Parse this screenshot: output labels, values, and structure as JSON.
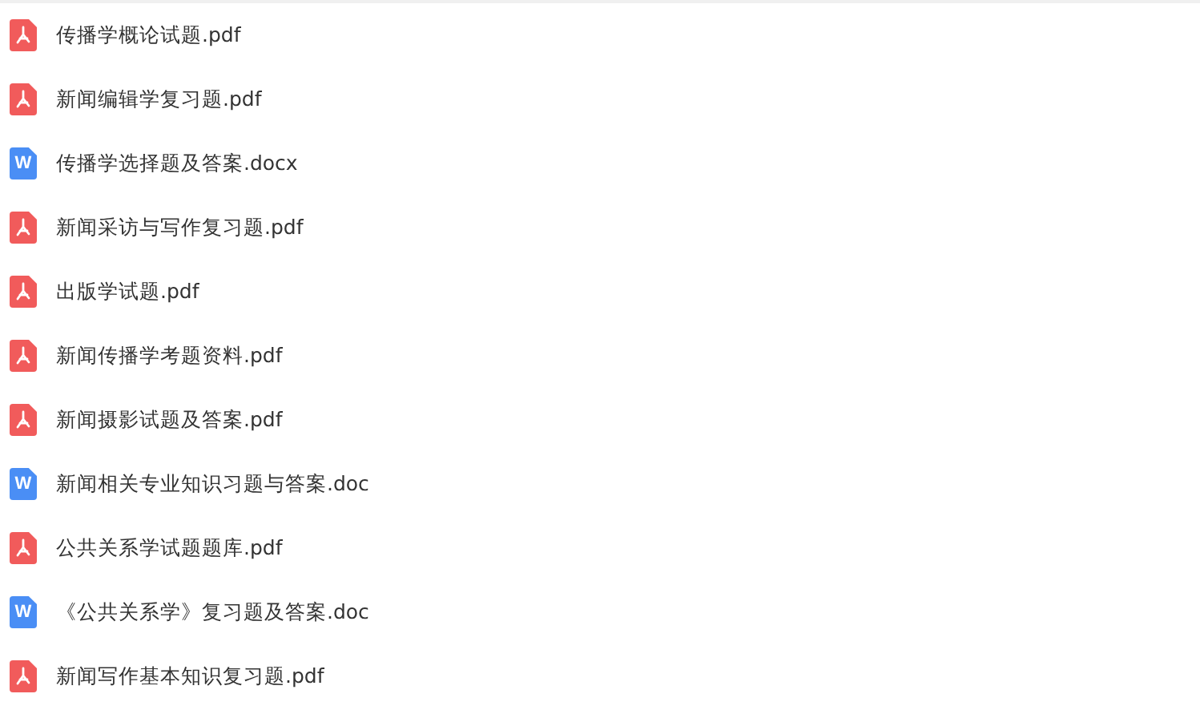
{
  "files": [
    {
      "kind": "pdf",
      "name": "传播学概论试题.pdf"
    },
    {
      "kind": "pdf",
      "name": "新闻编辑学复习题.pdf"
    },
    {
      "kind": "word",
      "name": "传播学选择题及答案.docx",
      "icon_letter": "W"
    },
    {
      "kind": "pdf",
      "name": "新闻采访与写作复习题.pdf"
    },
    {
      "kind": "pdf",
      "name": "出版学试题.pdf"
    },
    {
      "kind": "pdf",
      "name": "新闻传播学考题资料.pdf"
    },
    {
      "kind": "pdf",
      "name": "新闻摄影试题及答案.pdf"
    },
    {
      "kind": "word",
      "name": "新闻相关专业知识习题与答案.doc",
      "icon_letter": "W"
    },
    {
      "kind": "pdf",
      "name": "公共关系学试题题库.pdf"
    },
    {
      "kind": "word",
      "name": "《公共关系学》复习题及答案.doc",
      "icon_letter": "W"
    },
    {
      "kind": "pdf",
      "name": "新闻写作基本知识复习题.pdf"
    }
  ]
}
